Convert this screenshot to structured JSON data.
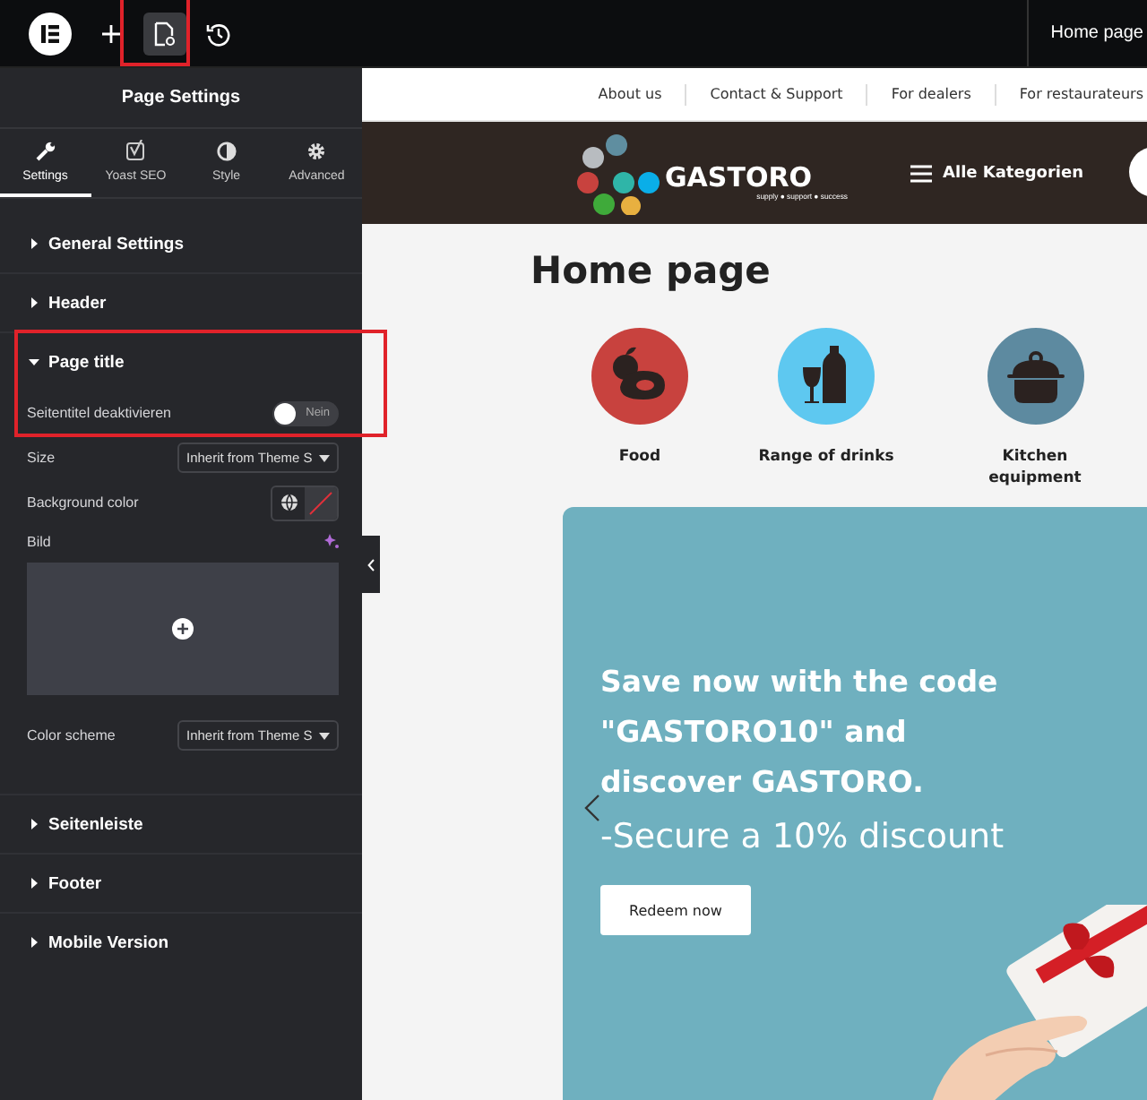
{
  "topbar": {
    "tools": [
      {
        "kind": "logo",
        "selected": false,
        "highlighted": false
      },
      {
        "kind": "add",
        "selected": false,
        "highlighted": false
      },
      {
        "kind": "page",
        "selected": true,
        "highlighted": true
      },
      {
        "kind": "history",
        "selected": false,
        "highlighted": false
      }
    ],
    "page_tab": "Home page"
  },
  "panel": {
    "title": "Page Settings",
    "tabs": [
      {
        "label": "Settings",
        "selected": true
      },
      {
        "label": "Yoast SEO",
        "selected": false
      },
      {
        "label": "Style",
        "selected": false
      },
      {
        "label": "Advanced",
        "selected": false
      }
    ],
    "sections": [
      {
        "title": "General Settings",
        "expanded": false,
        "highlighted": false
      },
      {
        "title": "Header",
        "expanded": false,
        "highlighted": false
      },
      {
        "title": "Page title",
        "expanded": true,
        "highlighted": true,
        "controls": [
          {
            "kind": "toggle",
            "label": "Seitentitel deaktivieren",
            "on": false,
            "text": "Nein"
          },
          {
            "kind": "select",
            "label": "Size",
            "value": "Inherit from Theme S"
          },
          {
            "kind": "color",
            "label": "Background color"
          },
          {
            "label": "Bild"
          },
          {
            "kind": "select",
            "label": "Color scheme",
            "value": "Inherit from Theme S"
          }
        ]
      },
      {
        "title": "Seitenleiste",
        "expanded": false,
        "highlighted": false
      },
      {
        "title": "Footer",
        "expanded": false,
        "highlighted": false
      },
      {
        "title": "Mobile Version",
        "expanded": false,
        "highlighted": false
      }
    ]
  },
  "preview": {
    "nav_links": [
      "About us",
      "Contact & Support",
      "For dealers",
      "For restaurateurs"
    ],
    "logo": {
      "name": "GASTORO",
      "tagline": "supply ● support ● success"
    },
    "menu_label": "Alle Kategorien",
    "page_title": "Home page",
    "categories": [
      {
        "label": "Food",
        "color": "#c8423e"
      },
      {
        "label": "Range of drinks",
        "color": "#5ec8f0"
      },
      {
        "label": "Kitchen equipment",
        "color": "#5d8aa0"
      }
    ],
    "banner": {
      "heading": "Save now with the code \"GASTORO10\" and discover GASTORO.",
      "subheading": "-Secure a 10% discount",
      "button": "Redeem now"
    }
  }
}
